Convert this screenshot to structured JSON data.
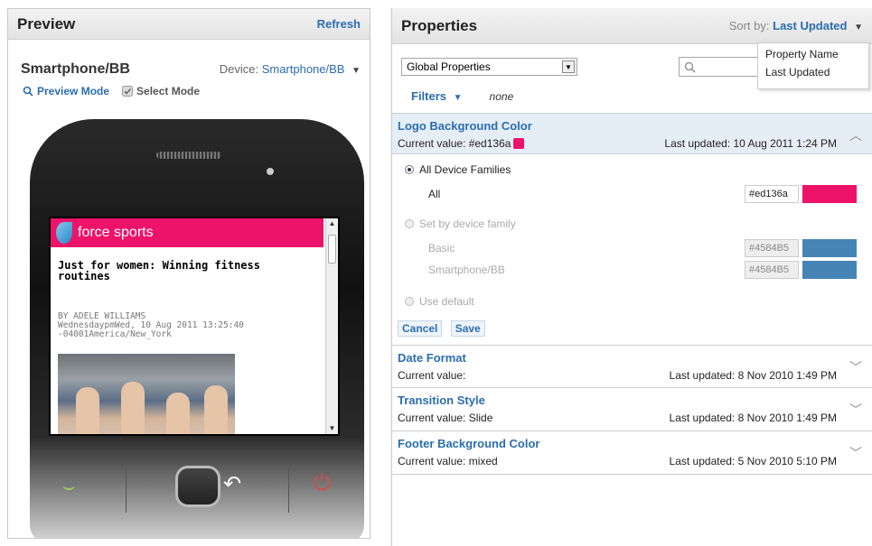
{
  "colors": {
    "accent": "#2b6db0",
    "brand_pink": "#ed136a",
    "device_blue": "#4584B5"
  },
  "preview": {
    "title": "Preview",
    "refresh": "Refresh",
    "device_name": "Smartphone/BB",
    "device_label": "Device:",
    "device_value": "Smartphone/BB",
    "preview_mode": "Preview Mode",
    "select_mode": "Select Mode",
    "screen": {
      "brand": "force sports",
      "article_title": "Just for women: Winning fitness routines",
      "byline": "BY ADELE WILLIAMS",
      "timestamp": "WednesdaypmWed, 10 Aug 2011 13:25:40 -04001America/New_York"
    }
  },
  "properties": {
    "title": "Properties",
    "sort_by_label": "Sort by:",
    "sort_by_value": "Last Updated",
    "sort_options": [
      "Property Name",
      "Last Updated"
    ],
    "scope_select": "Global Properties",
    "filters_label": "Filters",
    "filters_value": "none",
    "current_label": "Current value:",
    "items": [
      {
        "name": "Logo Background Color",
        "current": "Current value: #ed136a",
        "updated": "Last updated: 10 Aug 2011 1:24 PM"
      },
      {
        "name": "Date Format",
        "current": "Current value:",
        "updated": "Last updated: 8 Nov 2010 1:49 PM"
      },
      {
        "name": "Transition Style",
        "current": "Current value: Slide",
        "updated": "Last updated: 8 Nov 2010 1:49 PM"
      },
      {
        "name": "Footer Background Color",
        "current": "Current value: mixed",
        "updated": "Last updated: 5 Nov 2010 5:10 PM"
      }
    ],
    "editor": {
      "all_families": "All Device Families",
      "all_label": "All",
      "all_hex": "#ed136a",
      "by_family": "Set by device family",
      "basic_label": "Basic",
      "basic_hex": "#4584B5",
      "smartphone_label": "Smartphone/BB",
      "smartphone_hex": "#4584B5",
      "use_default": "Use default",
      "cancel": "Cancel",
      "save": "Save"
    }
  }
}
